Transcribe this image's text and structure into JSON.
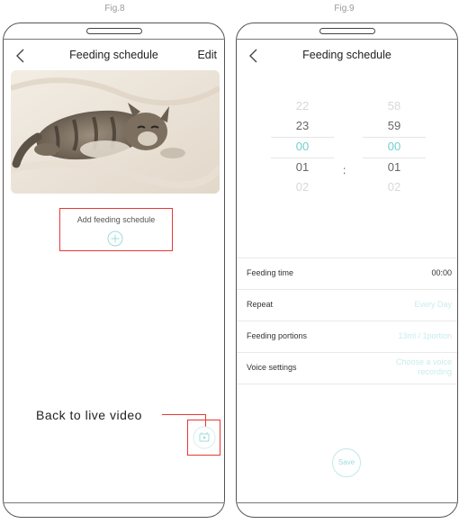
{
  "figures": [
    {
      "label": "Fig.8",
      "header": {
        "title": "Feeding schedule",
        "edit": "Edit"
      },
      "add_schedule_label": "Add feeding schedule",
      "callout": "Back to live video"
    },
    {
      "label": "Fig.9",
      "header": {
        "title": "Feeding schedule"
      },
      "picker": {
        "hours": [
          "22",
          "23",
          "00",
          "01",
          "02"
        ],
        "minutes": [
          "58",
          "59",
          "00",
          "01",
          "02"
        ],
        "separator": ":"
      },
      "settings": [
        {
          "label": "Feeding time",
          "value": "00:00"
        },
        {
          "label": "Repeat",
          "value": "Every Day"
        },
        {
          "label": "Feeding portions",
          "value": "13ml / 1portion"
        },
        {
          "label": "Voice settings",
          "value": "Choose a voice recording"
        }
      ],
      "save_label": "Save"
    }
  ],
  "colors": {
    "accent": "#6fd0ce",
    "highlight": "#e53935"
  },
  "icons": [
    "back-chevron-icon",
    "plus-circle-icon",
    "live-video-icon"
  ]
}
